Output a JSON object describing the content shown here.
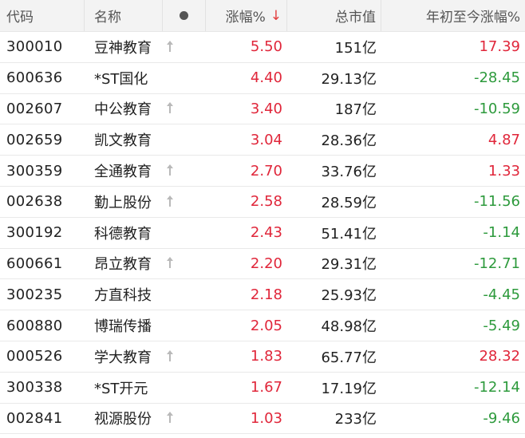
{
  "header": {
    "code": "代码",
    "name": "名称",
    "pct": "涨幅%",
    "sort_arrow": "↓",
    "cap": "总市值",
    "ytd": "年初至今涨幅%"
  },
  "colors": {
    "up": "#e0263a",
    "down": "#2d9a3c"
  },
  "rows": [
    {
      "code": "300010",
      "name": "豆神教育",
      "flag": true,
      "pct": "5.50",
      "cap": "151亿",
      "ytd": "17.39",
      "dir": "up"
    },
    {
      "code": "600636",
      "name": "*ST国化",
      "flag": false,
      "pct": "4.40",
      "cap": "29.13亿",
      "ytd": "-28.45",
      "dir": "down"
    },
    {
      "code": "002607",
      "name": "中公教育",
      "flag": true,
      "pct": "3.40",
      "cap": "187亿",
      "ytd": "-10.59",
      "dir": "down"
    },
    {
      "code": "002659",
      "name": "凯文教育",
      "flag": false,
      "pct": "3.04",
      "cap": "28.36亿",
      "ytd": "4.87",
      "dir": "up"
    },
    {
      "code": "300359",
      "name": "全通教育",
      "flag": true,
      "pct": "2.70",
      "cap": "33.76亿",
      "ytd": "1.33",
      "dir": "up"
    },
    {
      "code": "002638",
      "name": "勤上股份",
      "flag": true,
      "pct": "2.58",
      "cap": "28.59亿",
      "ytd": "-11.56",
      "dir": "down"
    },
    {
      "code": "300192",
      "name": "科德教育",
      "flag": false,
      "pct": "2.43",
      "cap": "51.41亿",
      "ytd": "-1.14",
      "dir": "down"
    },
    {
      "code": "600661",
      "name": "昂立教育",
      "flag": true,
      "pct": "2.20",
      "cap": "29.31亿",
      "ytd": "-12.71",
      "dir": "down"
    },
    {
      "code": "300235",
      "name": "方直科技",
      "flag": false,
      "pct": "2.18",
      "cap": "25.93亿",
      "ytd": "-4.45",
      "dir": "down"
    },
    {
      "code": "600880",
      "name": "博瑞传播",
      "flag": false,
      "pct": "2.05",
      "cap": "48.98亿",
      "ytd": "-5.49",
      "dir": "down"
    },
    {
      "code": "000526",
      "name": "学大教育",
      "flag": true,
      "pct": "1.83",
      "cap": "65.77亿",
      "ytd": "28.32",
      "dir": "up"
    },
    {
      "code": "300338",
      "name": "*ST开元",
      "flag": false,
      "pct": "1.67",
      "cap": "17.19亿",
      "ytd": "-12.14",
      "dir": "down"
    },
    {
      "code": "002841",
      "name": "视源股份",
      "flag": true,
      "pct": "1.03",
      "cap": "233亿",
      "ytd": "-9.46",
      "dir": "down"
    }
  ]
}
